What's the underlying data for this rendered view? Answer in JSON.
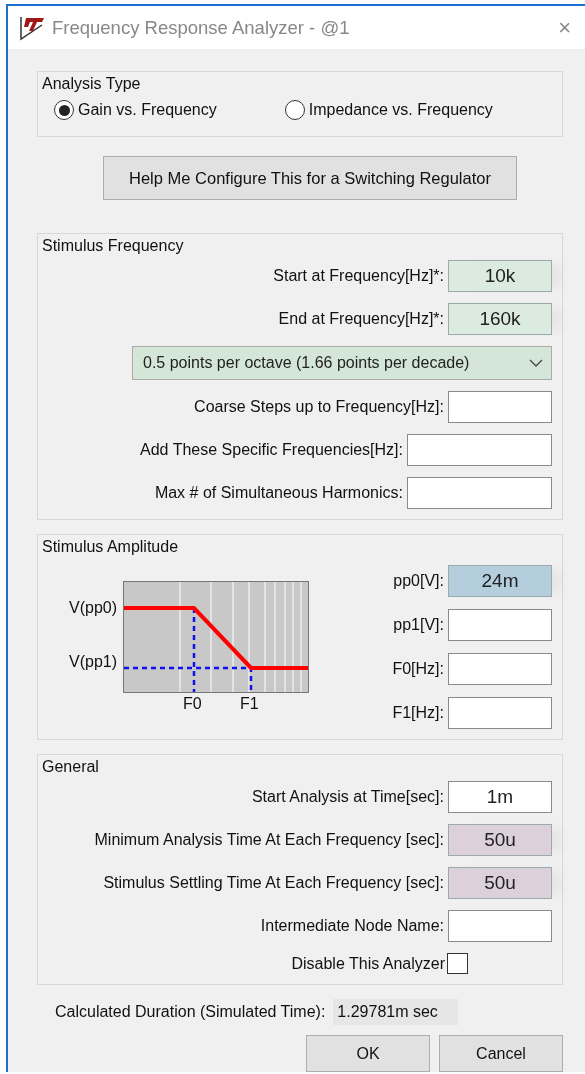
{
  "window": {
    "title": "Frequency Response Analyzer - @1",
    "close": "×"
  },
  "analysis_type": {
    "title": "Analysis Type",
    "options": [
      {
        "label": "Gain vs. Frequency",
        "selected": true
      },
      {
        "label": "Impedance vs. Frequency",
        "selected": false
      }
    ]
  },
  "help_button": "Help Me Configure This for a Switching Regulator",
  "stimulus_frequency": {
    "title": "Stimulus Frequency",
    "rows": [
      {
        "kind": "field",
        "label": "Start at Frequency[Hz]*:",
        "value": "10k",
        "color": "#dcebe0"
      },
      {
        "kind": "field",
        "label": "End at Frequency[Hz]*:",
        "value": "160k",
        "color": "#dcebe0"
      },
      {
        "kind": "dropdown",
        "value": "0.5 points per octave (1.66 points per decade)",
        "color": "#d4e6d8"
      },
      {
        "kind": "field",
        "label": "Coarse Steps up to Frequency[Hz]:"
      },
      {
        "kind": "wide_field",
        "label": "Add These Specific Frequencies[Hz]:"
      },
      {
        "kind": "wide_field",
        "label": "Max # of Simultaneous Harmonics:"
      }
    ]
  },
  "stimulus_amplitude": {
    "title": "Stimulus Amplitude",
    "diagram": {
      "y_labels": [
        "V(pp0)",
        "V(pp1)"
      ],
      "x_labels": [
        "F0",
        "F1"
      ]
    },
    "rows": [
      {
        "kind": "field",
        "label": "pp0[V]:",
        "value": "24m",
        "color": "#b4cedd"
      },
      {
        "kind": "field",
        "label": "pp1[V]:"
      },
      {
        "kind": "field",
        "label": "F0[Hz]:"
      },
      {
        "kind": "field",
        "label": "F1[Hz]:"
      }
    ]
  },
  "general": {
    "title": "General",
    "rows": [
      {
        "kind": "field",
        "label": "Start Analysis at Time[sec]:",
        "value": "1m"
      },
      {
        "kind": "field",
        "label": "Minimum Analysis Time At Each Frequency [sec]:",
        "value": "50u",
        "color": "#ddd0dd"
      },
      {
        "kind": "field",
        "label": "Stimulus Settling Time At Each Frequency [sec]:",
        "value": "50u",
        "color": "#ddd0dd"
      },
      {
        "kind": "field",
        "label": "Intermediate Node Name:"
      },
      {
        "kind": "checkbox",
        "label": "Disable This Analyzer",
        "checked": false
      }
    ]
  },
  "duration": {
    "label": "Calculated Duration (Simulated Time):",
    "value": "1.29781m sec"
  },
  "buttons": [
    "OK",
    "Cancel"
  ]
}
